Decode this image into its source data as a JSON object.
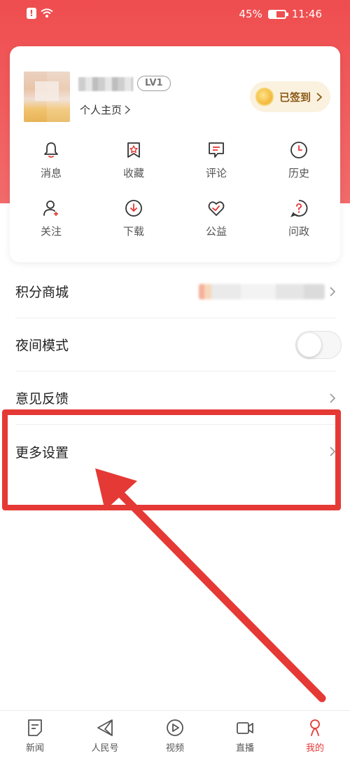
{
  "status_bar": {
    "battery": "45%",
    "time": "11:46",
    "battery_level": 0.45
  },
  "profile": {
    "level": "LV1",
    "homepage": "个人主页",
    "checkin": "已签到"
  },
  "grid": [
    {
      "label": "消息",
      "icon": "bell-icon"
    },
    {
      "label": "收藏",
      "icon": "star-icon"
    },
    {
      "label": "评论",
      "icon": "comment-icon"
    },
    {
      "label": "历史",
      "icon": "clock-icon"
    },
    {
      "label": "关注",
      "icon": "follow-icon"
    },
    {
      "label": "下载",
      "icon": "download-icon"
    },
    {
      "label": "公益",
      "icon": "heart-icon"
    },
    {
      "label": "问政",
      "icon": "question-icon"
    }
  ],
  "menu": {
    "points_mall": "积分商城",
    "night_mode": "夜间模式",
    "feedback": "意见反馈",
    "more_settings": "更多设置"
  },
  "bottom_nav": [
    {
      "label": "新闻",
      "icon": "news-icon"
    },
    {
      "label": "人民号",
      "icon": "send-icon"
    },
    {
      "label": "视频",
      "icon": "video-icon"
    },
    {
      "label": "直播",
      "icon": "live-camera-icon"
    },
    {
      "label": "我的",
      "icon": "profile-icon"
    }
  ],
  "colors": {
    "brand": "#ef4d4f",
    "annotation": "#e53935"
  }
}
